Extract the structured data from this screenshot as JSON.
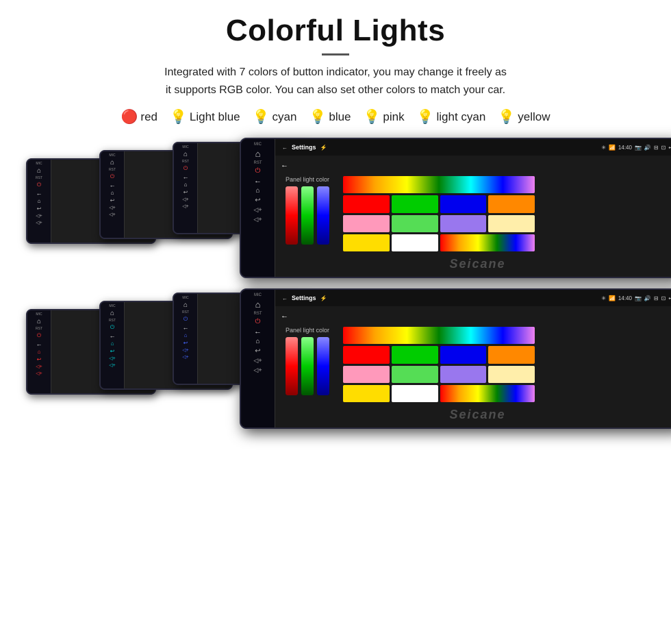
{
  "title": "Colorful Lights",
  "divider": "—",
  "description": "Integrated with 7 colors of button indicator, you may change it freely as\nit supports RGB color. You can also set other colors to match your car.",
  "colors": [
    {
      "name": "red",
      "color": "#ff2222",
      "emoji": "🔴"
    },
    {
      "name": "Light blue",
      "color": "#88ccff",
      "emoji": "💡"
    },
    {
      "name": "cyan",
      "color": "#00ffff",
      "emoji": "💡"
    },
    {
      "name": "blue",
      "color": "#3366ff",
      "emoji": "💡"
    },
    {
      "name": "pink",
      "color": "#ff66aa",
      "emoji": "💡"
    },
    {
      "name": "light cyan",
      "color": "#aaffff",
      "emoji": "💡"
    },
    {
      "name": "yellow",
      "color": "#ffee00",
      "emoji": "💡"
    }
  ],
  "settings_title": "Settings",
  "panel_light_label": "Panel light color",
  "status_time": "14:40",
  "watermark": "Seicane",
  "color_grid_cells": [
    "#ff0000",
    "#00cc00",
    "#0000ff",
    "#ff8800",
    "#ff6699",
    "#44dd44",
    "#8866ff",
    "#ffffff",
    "#ffcc00",
    "#ffffff",
    "#dddddd",
    "linear-gradient(to right, red, orange, yellow, green, blue, violet)"
  ]
}
